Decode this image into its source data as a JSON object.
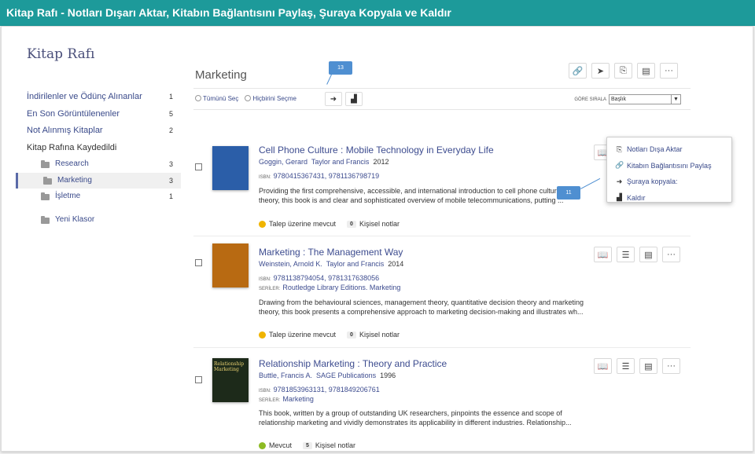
{
  "window": {
    "title": "Kitap Rafı - Notları Dışarı Aktar, Kitabın Bağlantısını Paylaş, Şuraya Kopyala ve Kaldır"
  },
  "sidebar": {
    "title": "Kitap Rafı",
    "items": [
      {
        "label": "İndirilenler ve Ödünç Alınanlar",
        "count": "1"
      },
      {
        "label": "En Son Görüntülenenler",
        "count": "5"
      },
      {
        "label": "Not Alınmış Kitaplar",
        "count": "2"
      },
      {
        "label": "Kitap Rafına Kaydedildi",
        "count": ""
      }
    ],
    "folders": [
      {
        "label": "Research",
        "count": "3"
      },
      {
        "label": "Marketing",
        "count": "3"
      },
      {
        "label": "İşletme",
        "count": "1"
      }
    ],
    "new_folder": "Yeni Klasor"
  },
  "main": {
    "title": "Marketing",
    "select_all": "Tümünü Seç",
    "select_none": "Hiçbirini Seçme",
    "sort_label": "GÖRE SIRALA",
    "sort_value": "Başlık"
  },
  "books": [
    {
      "title": "Cell Phone Culture : Mobile Technology in Everyday Life",
      "author": "Goggin, Gerard",
      "publisher": "Taylor and Francis",
      "year": "2012",
      "isbn_label": "ISBN:",
      "isbn": "9780415367431, 9781136798719",
      "series_label": "",
      "series": "",
      "description": "Providing the first comprehensive, accessible, and international introduction to cell phone culture and theory, this book is and clear and sophisticated overview of mobile telecommunications, putting ...",
      "status": "Talep üzerine mevcut",
      "notes_count": "0",
      "notes_label": "Kişisel notlar",
      "status_color": "#f0b400"
    },
    {
      "title": "Marketing : The Management Way",
      "author": "Weinstein, Arnold K.",
      "publisher": "Taylor and Francis",
      "year": "2014",
      "isbn_label": "ISBN:",
      "isbn": "9781138794054, 9781317638056",
      "series_label": "SERİLER:",
      "series": "Routledge Library Editions. Marketing",
      "description": "Drawing from the behavioural sciences, management theory, quantitative decision theory and marketing theory, this book presents a comprehensive approach to marketing decision-making and illustrates wh...",
      "status": "Talep üzerine mevcut",
      "notes_count": "0",
      "notes_label": "Kişisel notlar",
      "status_color": "#f0b400"
    },
    {
      "title": "Relationship Marketing : Theory and Practice",
      "author": "Buttle, Francis A.",
      "publisher": "SAGE Publications",
      "year": "1996",
      "isbn_label": "ISBN:",
      "isbn": "9781853963131, 9781849206761",
      "series_label": "SERİLER:",
      "series": "Marketing",
      "description": "This book, written by a group of outstanding UK researchers, pinpoints the essence and scope of relationship marketing and vividly demonstrates its applicability in different industries. Relationship...",
      "status": "Mevcut",
      "notes_count": "5",
      "notes_label": "Kişisel notlar",
      "status_color": "#8dbb24",
      "cover_text": "Relationship Marketing"
    }
  ],
  "dropdown": {
    "items": [
      {
        "label": "Notları Dışa Aktar",
        "icon": "export-icon"
      },
      {
        "label": "Kitabın Bağlantısını Paylaş",
        "icon": "link-icon"
      },
      {
        "label": "Şuraya kopyala:",
        "icon": "copy-arrow-icon"
      },
      {
        "label": "Kaldır",
        "icon": "remove-icon"
      }
    ]
  },
  "callouts": {
    "c13": "13",
    "c11": "11"
  },
  "colors": {
    "header": "#1d9a9a",
    "link": "#3d4c8f",
    "callout": "#4f8fd1"
  }
}
